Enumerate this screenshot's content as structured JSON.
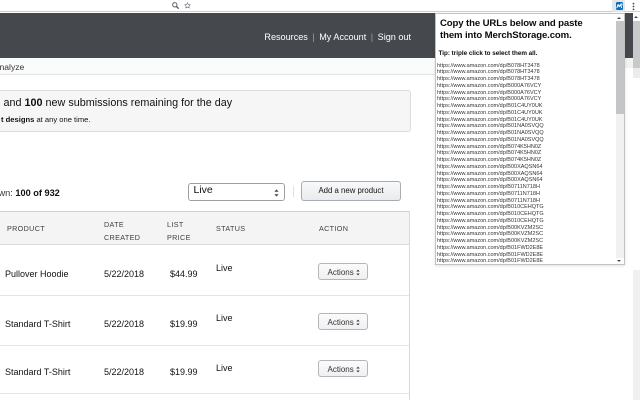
{
  "browser": {
    "extension_badge": "M",
    "icons": {
      "zoom": "magnifier-icon",
      "bookmark": "star-icon",
      "menu": "kebab-menu-icon"
    }
  },
  "navbar": {
    "links": [
      {
        "label": "Resources"
      },
      {
        "label": "My Account"
      },
      {
        "label": "Sign out"
      }
    ]
  },
  "tabbar": {
    "active_tab_partial": "nalyze"
  },
  "banner": {
    "line1_prefix": " and ",
    "line1_bold": "100",
    "line1_suffix": " new submissions remaining for the day",
    "line2_bold": "t designs",
    "line2_suffix": " at any one time."
  },
  "products": {
    "shown_prefix": "wn: ",
    "shown_count": "100 of 932",
    "filter_value": "Live",
    "add_button_label": "Add a new product",
    "table": {
      "headers": {
        "product": "PRODUCT",
        "date1": "DATE",
        "date2": "CREATED",
        "price1": "LIST",
        "price2": "PRICE",
        "status": "STATUS",
        "action": "ACTION"
      },
      "rows": [
        {
          "product": "Pullover Hoodie",
          "date": "5/22/2018",
          "price": "$44.99",
          "status": "Live",
          "action": "Actions"
        },
        {
          "product": "Standard T-Shirt",
          "date": "5/22/2018",
          "price": "$19.99",
          "status": "Live",
          "action": "Actions"
        },
        {
          "product": "Standard T-Shirt",
          "date": "5/22/2018",
          "price": "$19.99",
          "status": "Live",
          "action": "Actions"
        }
      ]
    }
  },
  "popup": {
    "title": "Copy the URLs below and paste them into MerchStorage.com.",
    "tip": "Tip: triple click to select them all.",
    "urls": [
      "https://www.amazon.com/dp/B078HT3478",
      "https://www.amazon.com/dp/B078HT3478",
      "https://www.amazon.com/dp/B078HT3478",
      "https://www.amazon.com/dp/B000A76VCY",
      "https://www.amazon.com/dp/B000A76VCY",
      "https://www.amazon.com/dp/B000A76VCY",
      "https://www.amazon.com/dp/B01C4UY0UK",
      "https://www.amazon.com/dp/B01C4UY0UK",
      "https://www.amazon.com/dp/B01C4UY0UK",
      "https://www.amazon.com/dp/B01NA0SVQQ",
      "https://www.amazon.com/dp/B01NA0SVQQ",
      "https://www.amazon.com/dp/B01NA0SVQQ",
      "https://www.amazon.com/dp/B074K5HN0Z",
      "https://www.amazon.com/dp/B074K5HN0Z",
      "https://www.amazon.com/dp/B074K5HN0Z",
      "https://www.amazon.com/dp/B00XAQSN64",
      "https://www.amazon.com/dp/B00XAQSN64",
      "https://www.amazon.com/dp/B00XAQSN64",
      "https://www.amazon.com/dp/B0711N718H",
      "https://www.amazon.com/dp/B0711N718H",
      "https://www.amazon.com/dp/B0711N718H",
      "https://www.amazon.com/dp/B010CEHQTG",
      "https://www.amazon.com/dp/B010CEHQTG",
      "https://www.amazon.com/dp/B010CEHQTG",
      "https://www.amazon.com/dp/B00KVZM2SC",
      "https://www.amazon.com/dp/B00KVZM2SC",
      "https://www.amazon.com/dp/B00KVZM2SC",
      "https://www.amazon.com/dp/B01FWD2E8E",
      "https://www.amazon.com/dp/B01FWD2E8E",
      "https://www.amazon.com/dp/B01FWD2E8E"
    ]
  },
  "colors": {
    "navbar": "#45494d",
    "extension_icon": "#0d6cb5",
    "popup_border": "#c2c2c2"
  }
}
